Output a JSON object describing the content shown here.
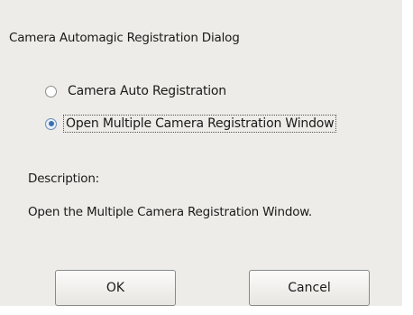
{
  "dialog": {
    "title": "Camera Automagic Registration Dialog",
    "options": [
      {
        "label": "Camera Auto Registration",
        "selected": false
      },
      {
        "label": "Open Multiple Camera Registration Window",
        "selected": true
      }
    ],
    "description_heading": "Description:",
    "description_text": "Open the Multiple Camera Registration Window.",
    "buttons": {
      "ok_label": "OK",
      "cancel_label": "Cancel"
    }
  }
}
